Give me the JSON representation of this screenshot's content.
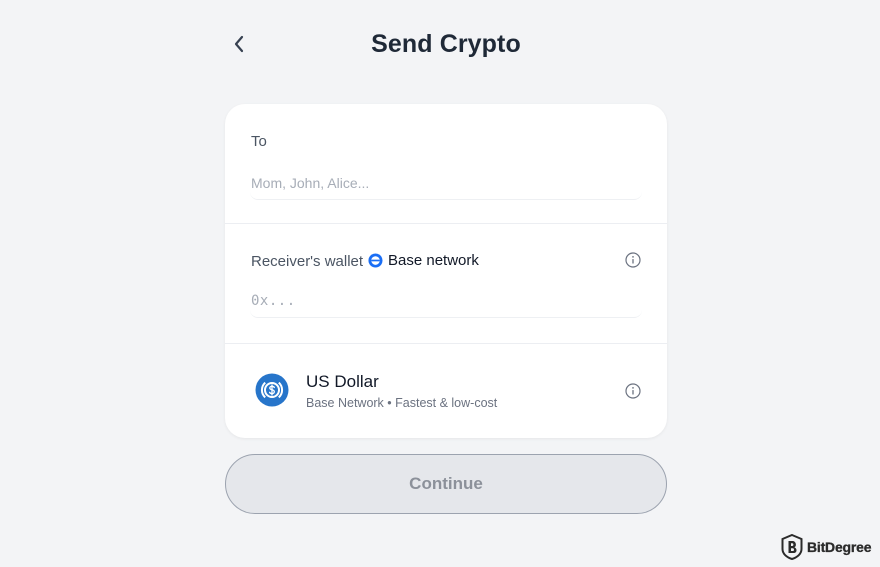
{
  "header": {
    "title": "Send Crypto",
    "back_icon": "chevron-left-icon"
  },
  "recipient": {
    "label": "To",
    "placeholder": "Mom, John, Alice..."
  },
  "wallet": {
    "label": "Receiver's wallet",
    "network_name": "Base network",
    "network_icon": "base-network-icon",
    "placeholder": "0x...",
    "info_icon": "info-icon"
  },
  "token": {
    "name": "US Dollar",
    "subtitle": "Base Network • Fastest & low-cost",
    "logo_icon": "usdc-logo-icon",
    "info_icon": "info-icon"
  },
  "actions": {
    "continue_label": "Continue"
  },
  "watermark": {
    "text": "BitDegree"
  },
  "colors": {
    "background": "#f3f4f6",
    "card": "#ffffff",
    "base_blue": "#1a6ef5",
    "usdc_blue": "#2775ca",
    "button_bg": "#e5e7eb",
    "button_text": "#8c919a"
  }
}
